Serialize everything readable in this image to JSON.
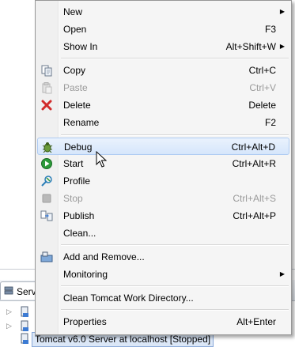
{
  "background": {
    "servers_tab_label": "Serv",
    "tree": [
      {
        "label": ""
      },
      {
        "label": ""
      },
      {
        "label": "Tomcat v6.0 Server at localhost  [Stopped]"
      }
    ]
  },
  "menu": {
    "items": [
      {
        "label": "New",
        "accel": "",
        "submenu": true
      },
      {
        "label": "Open",
        "accel": "F3"
      },
      {
        "label": "Show In",
        "accel": "Alt+Shift+W",
        "submenu": true
      },
      {
        "label": "Copy",
        "accel": "Ctrl+C",
        "icon": "copy-icon"
      },
      {
        "label": "Paste",
        "accel": "Ctrl+V",
        "icon": "paste-icon",
        "disabled": true
      },
      {
        "label": "Delete",
        "accel": "Delete",
        "icon": "delete-icon"
      },
      {
        "label": "Rename",
        "accel": "F2"
      },
      {
        "label": "Debug",
        "accel": "Ctrl+Alt+D",
        "icon": "debug-icon",
        "hovered": true
      },
      {
        "label": "Start",
        "accel": "Ctrl+Alt+R",
        "icon": "start-icon"
      },
      {
        "label": "Profile",
        "accel": "",
        "icon": "profile-icon"
      },
      {
        "label": "Stop",
        "accel": "Ctrl+Alt+S",
        "icon": "stop-icon",
        "disabled": true
      },
      {
        "label": "Publish",
        "accel": "Ctrl+Alt+P",
        "icon": "publish-icon"
      },
      {
        "label": "Clean...",
        "accel": ""
      },
      {
        "label": "Add and Remove...",
        "accel": "",
        "icon": "add-remove-icon"
      },
      {
        "label": "Monitoring",
        "accel": "",
        "submenu": true
      },
      {
        "label": "Clean Tomcat Work Directory...",
        "accel": ""
      },
      {
        "label": "Properties",
        "accel": "Alt+Enter"
      }
    ]
  },
  "colors": {
    "hover_border": "#aecbf2",
    "disabled_text": "#9a9a9a",
    "delete_red": "#d12b2b",
    "start_green": "#2c9a3a"
  }
}
